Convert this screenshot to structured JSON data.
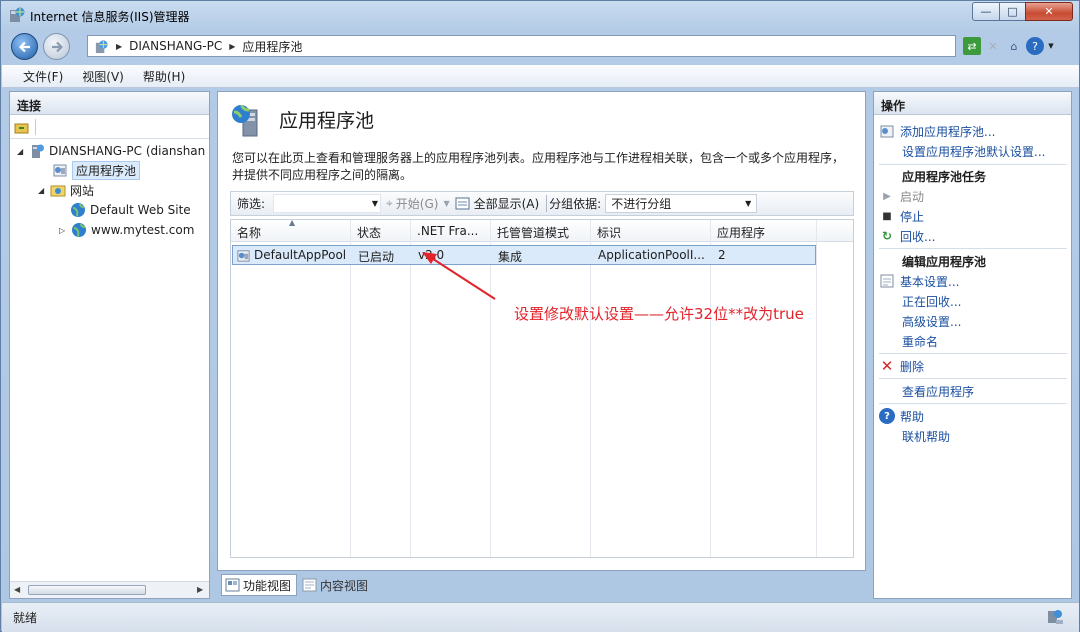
{
  "window": {
    "title": "Internet 信息服务(IIS)管理器",
    "controls": {
      "minimize": "—",
      "maximize": "□",
      "close": "✕"
    }
  },
  "nav": {
    "breadcrumb": [
      "DIANSHANG-PC",
      "应用程序池"
    ]
  },
  "menu": {
    "items": [
      "文件(F)",
      "视图(V)",
      "帮助(H)"
    ]
  },
  "connections": {
    "title": "连接",
    "tree": {
      "server": "DIANSHANG-PC (dianshan",
      "app_pools": "应用程序池",
      "sites": "网站",
      "site1": "Default Web Site",
      "site2": "www.mytest.com"
    }
  },
  "center": {
    "title": "应用程序池",
    "description": "您可以在此页上查看和管理服务器上的应用程序池列表。应用程序池与工作进程相关联，包含一个或多个应用程序，并提供不同应用程序之间的隔离。",
    "filter": {
      "label": "筛选:",
      "start": "开始(G)",
      "show_all": "全部显示(A)",
      "group_by": "分组依据:",
      "group_value": "不进行分组"
    },
    "columns": [
      "名称",
      "状态",
      ".NET Fra...",
      "托管管道模式",
      "标识",
      "应用程序"
    ],
    "rows": [
      [
        "DefaultAppPool",
        "已启动",
        "v2.0",
        "集成",
        "ApplicationPoolI...",
        "2"
      ]
    ],
    "annotation": "设置修改默认设置——允许32位**改为true"
  },
  "view_tabs": {
    "features": "功能视图",
    "content": "内容视图"
  },
  "actions": {
    "title": "操作",
    "add_pool": "添加应用程序池...",
    "set_defaults": "设置应用程序池默认设置...",
    "tasks_heading": "应用程序池任务",
    "start": "启动",
    "stop": "停止",
    "recycle": "回收...",
    "edit_heading": "编辑应用程序池",
    "basic_settings": "基本设置...",
    "recycling": "正在回收...",
    "advanced_settings": "高级设置...",
    "rename": "重命名",
    "delete": "删除",
    "view_apps": "查看应用程序",
    "help": "帮助",
    "online_help": "联机帮助"
  },
  "status": {
    "text": "就绪"
  },
  "colors": {
    "annotation": "#e2232a",
    "link": "#1a4fa0",
    "selection": "#dbeafa"
  }
}
